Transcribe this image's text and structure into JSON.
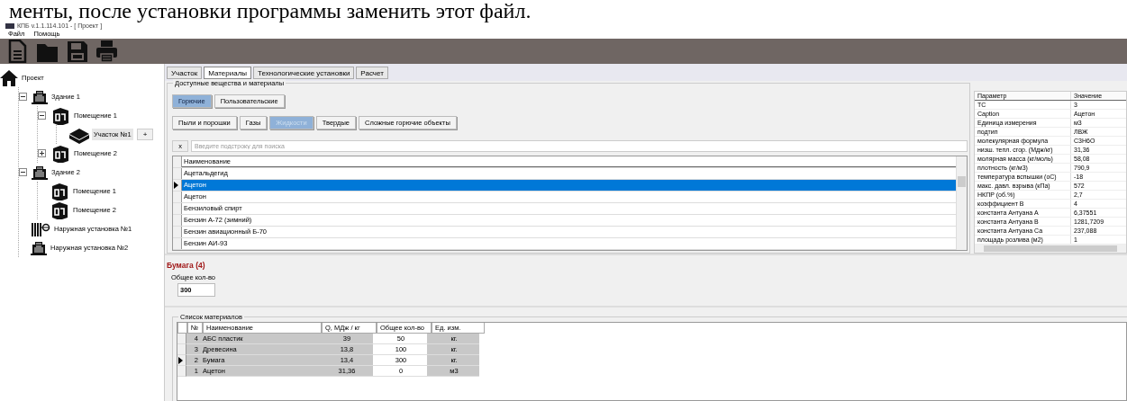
{
  "document_text": "менты, после установки программы заменить этот файл.",
  "window": {
    "title": "КПБ v.1.1.114.101 - [ Проект ]"
  },
  "menu": [
    "Файл",
    "Помощь"
  ],
  "toolbar": [
    {
      "kind": "new"
    },
    {
      "kind": "open"
    },
    {
      "kind": "save"
    },
    {
      "kind": "print"
    }
  ],
  "tree": {
    "label": "Проект",
    "kind": "home",
    "selected": false,
    "children": [
      {
        "label": "Здание 1",
        "kind": "building",
        "selected": false,
        "expanded": true,
        "children": [
          {
            "label": "Помещение 1",
            "kind": "room",
            "selected": false,
            "expanded": true,
            "children": [
              {
                "label": "Участок №1",
                "kind": "section",
                "selected": true,
                "action": "+"
              }
            ]
          },
          {
            "label": "Помещение 2",
            "kind": "room",
            "selected": false,
            "expanded": false
          }
        ]
      },
      {
        "label": "Здание 2",
        "kind": "building",
        "selected": false,
        "expanded": true,
        "children": [
          {
            "label": "Помещение 1",
            "kind": "room",
            "selected": false
          },
          {
            "label": "Помещение 2",
            "kind": "room",
            "selected": false
          }
        ]
      },
      {
        "label": "Наружная установка №1",
        "kind": "outdoor",
        "selected": false
      },
      {
        "label": "Наружная установка №2",
        "kind": "building",
        "selected": false
      }
    ]
  },
  "tabs": [
    {
      "label": "Участок",
      "selected": false
    },
    {
      "label": "Материалы",
      "selected": true
    },
    {
      "label": "Технологические установки",
      "selected": false
    },
    {
      "label": "Расчет",
      "selected": false
    }
  ],
  "materials": {
    "title": "Доступные вещества и материалы",
    "categories": [
      {
        "label": "Горючие",
        "selected": true
      },
      {
        "label": "Пользовательские",
        "selected": false
      }
    ],
    "types": [
      {
        "label": "Пыли и порошки",
        "selected": false
      },
      {
        "label": "Газы",
        "selected": false
      },
      {
        "label": "Жидкости",
        "selected": true
      },
      {
        "label": "Твердые",
        "selected": false
      },
      {
        "label": "Сложные горючие объекты",
        "selected": false
      }
    ],
    "search": {
      "clear_label": "x",
      "placeholder": "Введите подстроку для поиска"
    },
    "column": "Наименование",
    "rows": [
      {
        "name": "Ацетальдегид",
        "selected": false
      },
      {
        "name": "Ацетон",
        "selected": true
      },
      {
        "name": "Ацетон",
        "selected": false
      },
      {
        "name": "Бензиловый спирт",
        "selected": false
      },
      {
        "name": "Бензин А-72 (зимний)",
        "selected": false
      },
      {
        "name": "Бензин авиационный Б-70",
        "selected": false
      },
      {
        "name": "Бензин АИ-93",
        "selected": false
      }
    ]
  },
  "params": {
    "columns": [
      "Параметр",
      "Значение"
    ],
    "rows": [
      [
        "ТС",
        "3"
      ],
      [
        "Caption",
        "Ацетон"
      ],
      [
        "Единица измерения",
        "м3"
      ],
      [
        "подтип",
        "ЛВЖ"
      ],
      [
        "молекулярная формула",
        "С3Н6О"
      ],
      [
        "низш. тепл. сгор. (Мдж/кг)",
        "31,36"
      ],
      [
        "молярная масса (кг/моль)",
        "58,08"
      ],
      [
        "плотность (кг/м3)",
        "790,9"
      ],
      [
        "температура вспышки (оС)",
        "-18"
      ],
      [
        "макс. давл. взрыва (кПа)",
        "572"
      ],
      [
        "НКПР (об.%)",
        "2,7"
      ],
      [
        "коэффициент В",
        "4"
      ],
      [
        "константа Антуана А",
        "6,37551"
      ],
      [
        "константа Антуана В",
        "1281,7209"
      ],
      [
        "константа Антуана Са",
        "237,088"
      ],
      [
        "площадь розлива (м2)",
        "1"
      ]
    ]
  },
  "current": {
    "title": "Бумага (4)",
    "quantity_label": "Общее кол-во",
    "quantity_value": "300"
  },
  "list": {
    "title": "Список материалов",
    "columns": [
      "№",
      "Наименование",
      "Q, МДж / кг",
      "Общее кол-во",
      "Ед. изм."
    ],
    "rows": [
      {
        "cells": [
          "4",
          "АБС пластик",
          "39",
          "50",
          "кг."
        ],
        "selected": false
      },
      {
        "cells": [
          "3",
          "Древесина",
          "13,8",
          "100",
          "кг."
        ],
        "selected": false
      },
      {
        "cells": [
          "2",
          "Бумага",
          "13,4",
          "300",
          "кг."
        ],
        "selected": true
      },
      {
        "cells": [
          "1",
          "Ацетон",
          "31,36",
          "0",
          "м3"
        ],
        "selected": false
      }
    ]
  }
}
